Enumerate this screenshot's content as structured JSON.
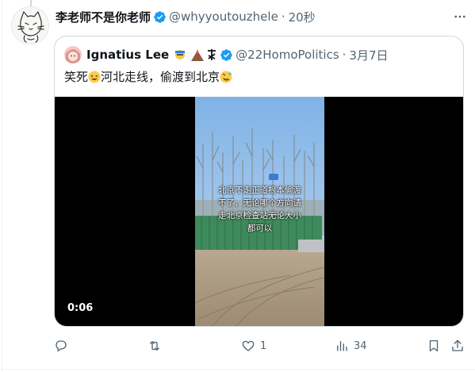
{
  "tweet": {
    "display_name": "李老师不是你老师",
    "handle": "@whyyoutouzhele",
    "separator": "·",
    "time": "20秒"
  },
  "quoted": {
    "display_name": "Ignatius Lee",
    "handle": "@22HomoPolitics",
    "separator": "·",
    "date": "3月7日",
    "text_part1": "笑死",
    "text_part2": "河北走线，偷渡到北京",
    "video": {
      "caption_lines": [
        "北京不走正道根本偷渡",
        "不了，无论哪个方向请",
        "走北京检查站无论大小",
        "都可以"
      ],
      "duration": "0:06"
    }
  },
  "actions": {
    "reply_count": "",
    "retweet_count": "",
    "like_count": "1",
    "views_count": "34"
  },
  "colors": {
    "verified": "#1d9bf0",
    "muted": "#536471",
    "border": "#cfd9de"
  }
}
